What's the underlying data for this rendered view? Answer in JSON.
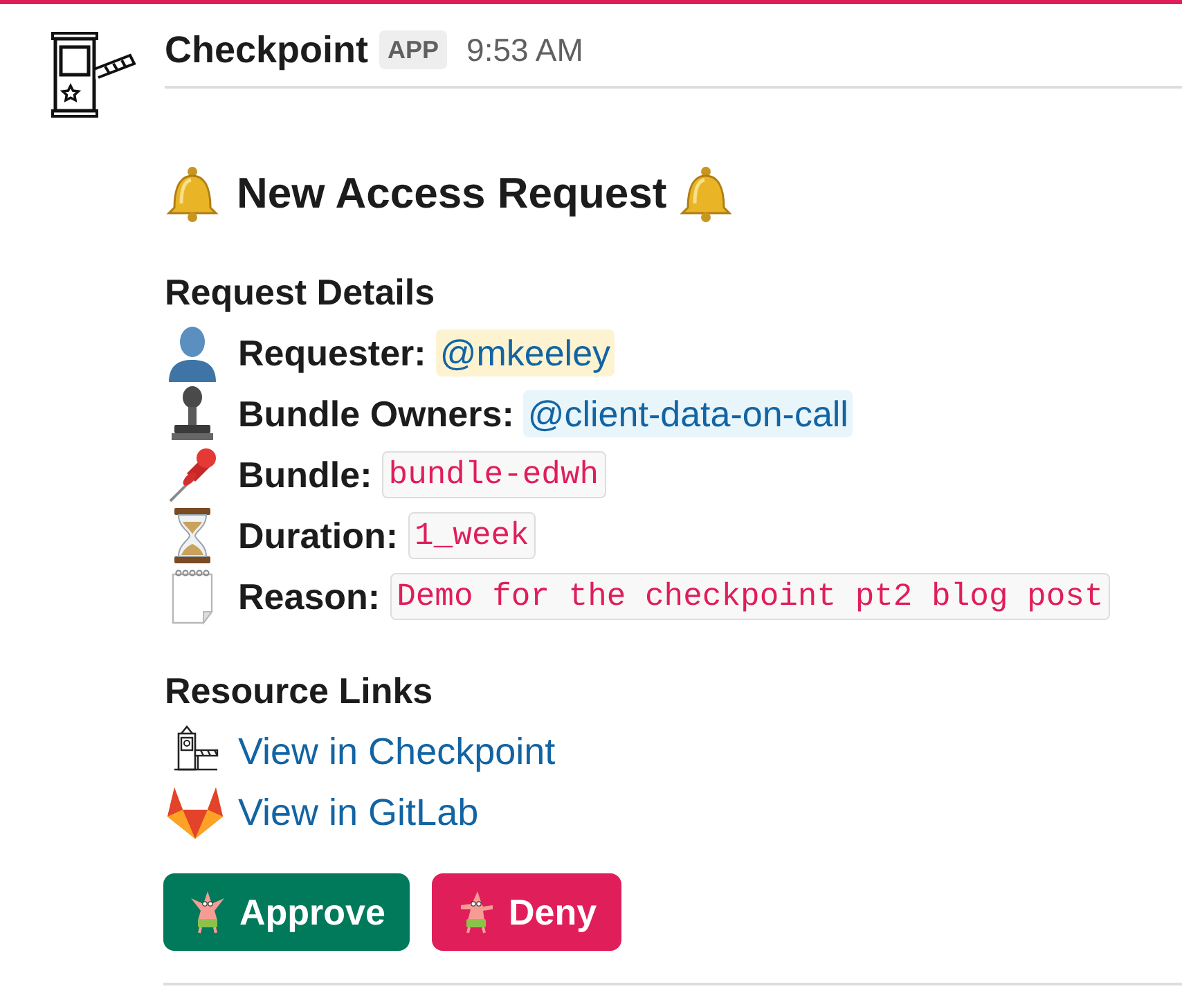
{
  "message": {
    "sender": "Checkpoint",
    "badge": "APP",
    "time": "9:53 AM"
  },
  "title": "New Access Request",
  "details": {
    "heading": "Request Details",
    "fields": [
      {
        "label": "Requester:",
        "value": "@mkeeley",
        "kind": "user_mention"
      },
      {
        "label": "Bundle Owners:",
        "value": "@client-data-on-call",
        "kind": "group_mention"
      },
      {
        "label": "Bundle:",
        "value": "bundle-edwh",
        "kind": "code"
      },
      {
        "label": "Duration:",
        "value": "1_week",
        "kind": "code"
      },
      {
        "label": "Reason:",
        "value": "Demo for the checkpoint pt2 blog post",
        "kind": "code"
      }
    ]
  },
  "links": {
    "heading": "Resource Links",
    "items": [
      {
        "label": "View in Checkpoint"
      },
      {
        "label": "View in GitLab"
      }
    ]
  },
  "actions": [
    {
      "label": "Approve",
      "kind": "approve"
    },
    {
      "label": "Deny",
      "kind": "deny"
    }
  ]
}
